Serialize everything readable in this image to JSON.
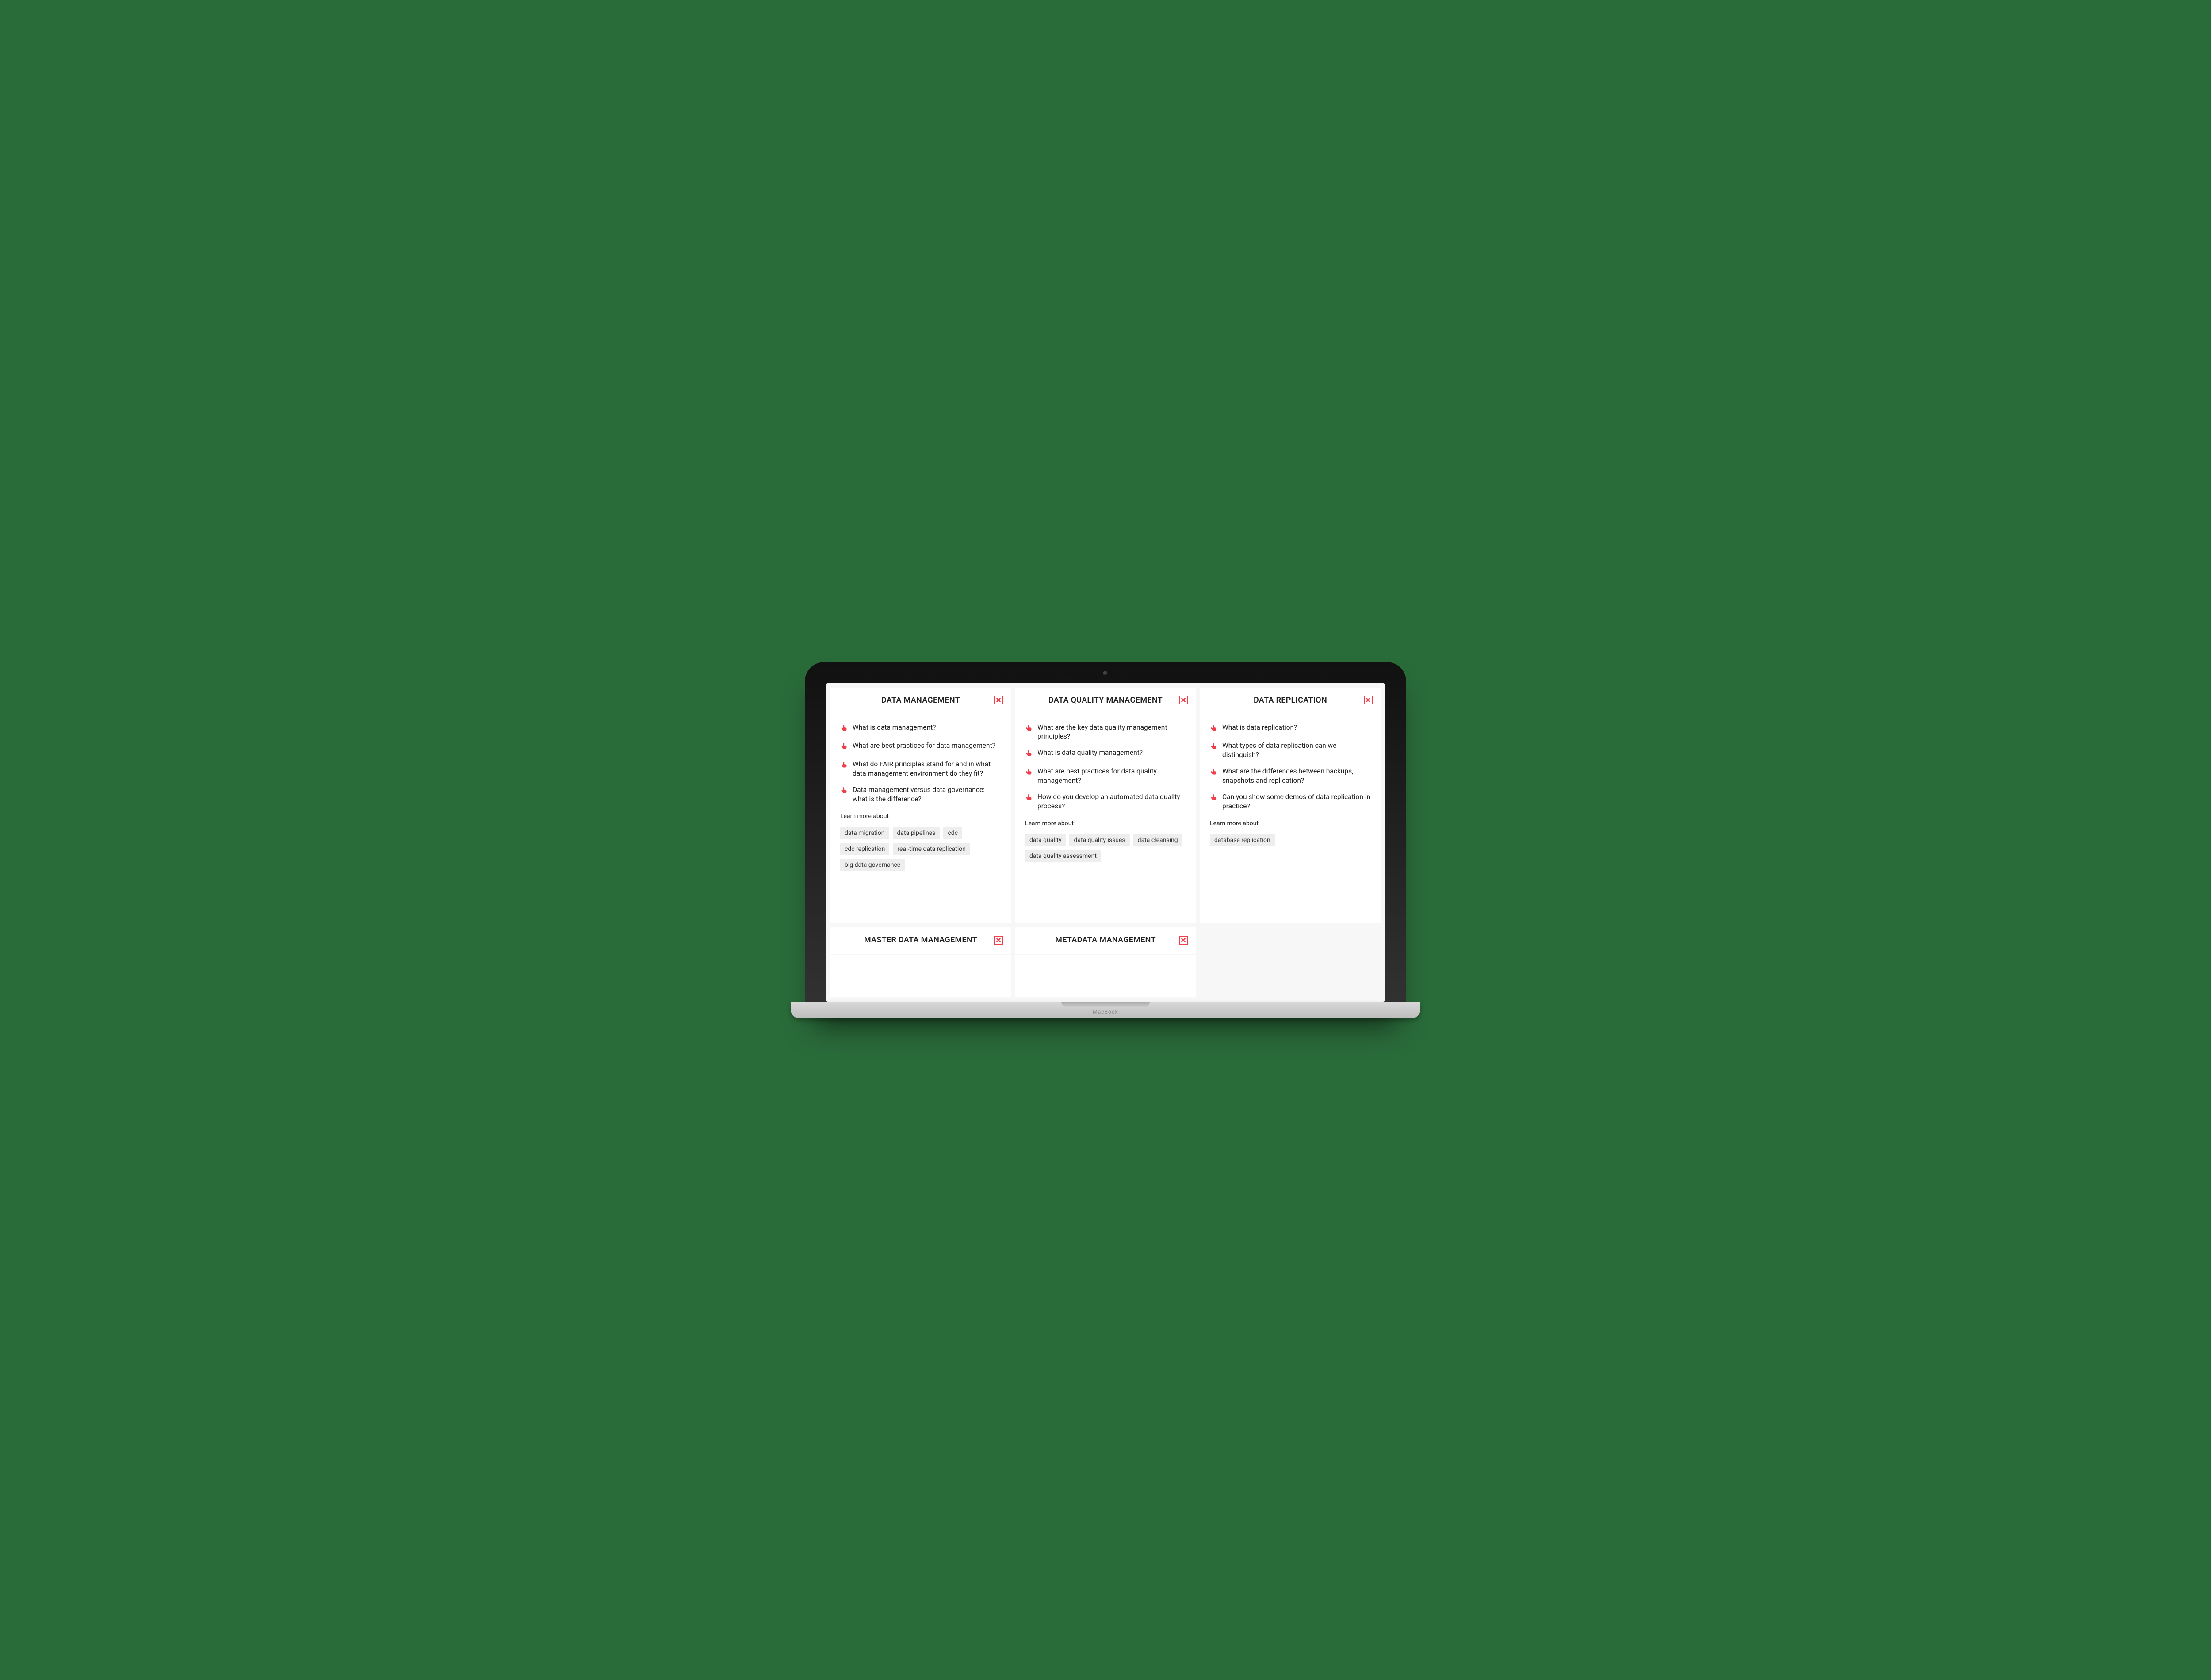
{
  "device_brand": "MacBook",
  "learn_more_label": "Learn more about",
  "cards": [
    {
      "title": "DATA MANAGEMENT",
      "questions": [
        "What is data management?",
        "What are best practices for data management?",
        "What do FAIR principles stand for and in what data management environment do they fit?",
        "Data management versus data governance: what is the difference?"
      ],
      "tags": [
        "data migration",
        "data pipelines",
        "cdc",
        "cdc replication",
        "real-time data replication",
        "big data governance"
      ]
    },
    {
      "title": "DATA QUALITY MANAGEMENT",
      "questions": [
        "What are the key data quality management principles?",
        "What is data quality management?",
        "What are best practices for data quality management?",
        "How do you develop an automated data quality process?"
      ],
      "tags": [
        "data quality",
        "data quality issues",
        "data cleansing",
        "data quality assessment"
      ]
    },
    {
      "title": "DATA REPLICATION",
      "questions": [
        "What is data replication?",
        "What types of data replication can we distinguish?",
        "What are the differences between backups, snapshots and replication?",
        "Can you show some demos of data replication in practice?"
      ],
      "tags": [
        "database replication"
      ]
    },
    {
      "title": "MASTER DATA MANAGEMENT",
      "questions": [],
      "tags": []
    },
    {
      "title": "METADATA MANAGEMENT",
      "questions": [],
      "tags": []
    }
  ]
}
